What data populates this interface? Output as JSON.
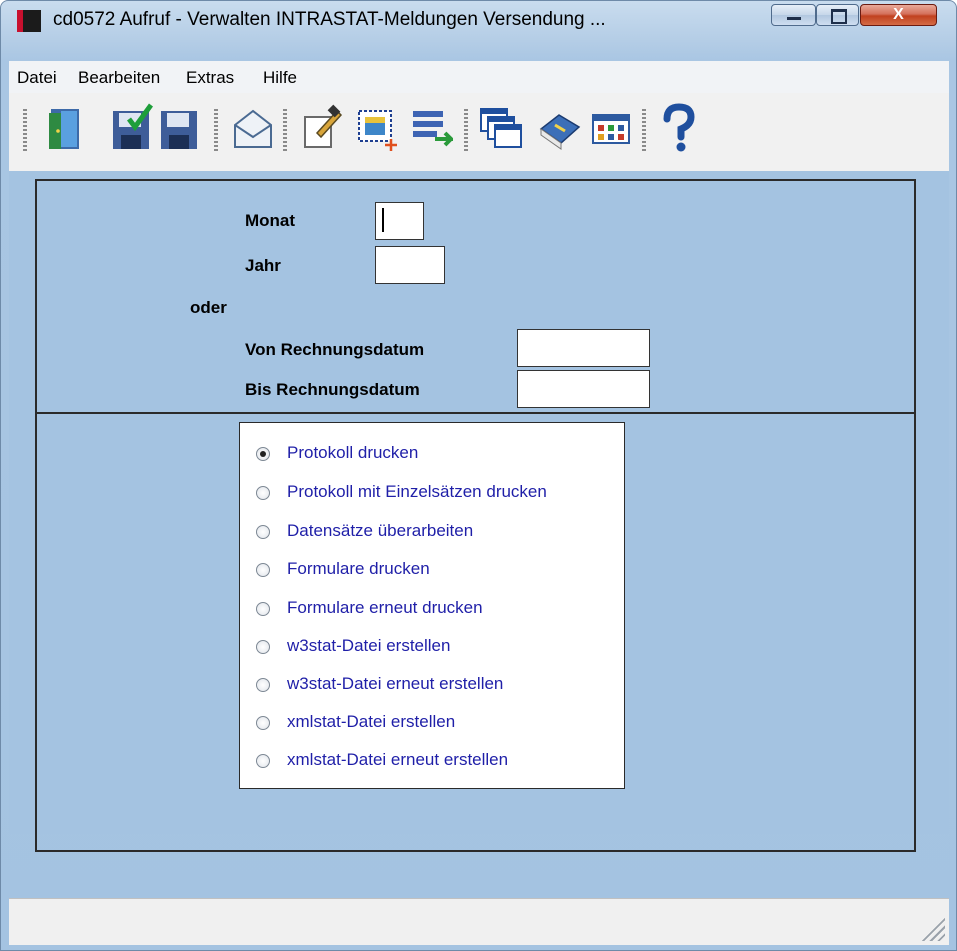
{
  "window": {
    "title": "cd0572 Aufruf - Verwalten INTRASTAT-Meldungen Versendung ...",
    "controls": {
      "minimize": "",
      "maximize": "",
      "close": "X"
    }
  },
  "menu": [
    "Datei",
    "Bearbeiten",
    "Extras",
    "Hilfe"
  ],
  "toolbar": [
    "exit-door-icon",
    "save-check-icon",
    "save-icon",
    "mail-envelope-icon",
    "edit-document-icon",
    "new-record-icon",
    "transfer-list-icon",
    "windows-cascade-icon",
    "book-icon",
    "grid-table-icon",
    "help-question-icon"
  ],
  "form": {
    "monat_label": "Monat",
    "jahr_label": "Jahr",
    "oder_label": "oder",
    "von_label": "Von Rechnungsdatum",
    "bis_label": "Bis Rechnungsdatum",
    "monat_value": "",
    "jahr_value": "",
    "von_value": "",
    "bis_value": ""
  },
  "options": {
    "selected": 0,
    "items": [
      "Protokoll drucken",
      "Protokoll mit Einzelsätzen drucken",
      "Datensätze überarbeiten",
      "Formulare drucken",
      "Formulare erneut drucken",
      "w3stat-Datei erstellen",
      "w3stat-Datei erneut erstellen",
      "xmlstat-Datei erstellen",
      "xmlstat-Datei erneut erstellen"
    ]
  },
  "status": {
    "text": ""
  },
  "colors": {
    "background": "#a4c3e1",
    "option_text": "#1f1fa8",
    "panel_border": "#2a2a2a"
  }
}
